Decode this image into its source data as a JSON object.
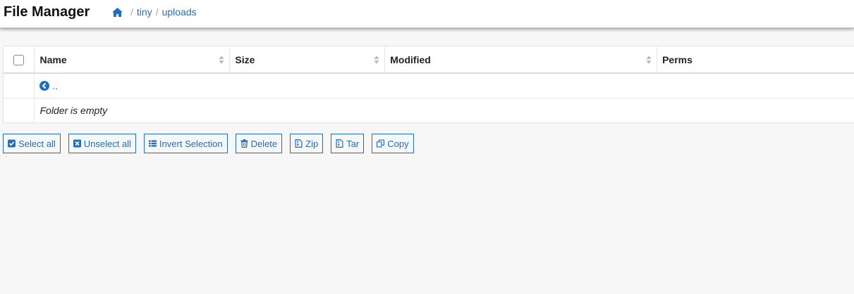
{
  "header": {
    "app_title": "File Manager",
    "breadcrumb": [
      {
        "label": "tiny"
      },
      {
        "label": "uploads"
      }
    ],
    "separator": "/"
  },
  "table": {
    "columns": {
      "name": "Name",
      "size": "Size",
      "modified": "Modified",
      "perms": "Perms"
    },
    "parent_link": "..",
    "empty_message": "Folder is empty"
  },
  "actions": {
    "select_all": "Select all",
    "unselect_all": "Unselect all",
    "invert_selection": "Invert Selection",
    "delete": "Delete",
    "zip": "Zip",
    "tar": "Tar",
    "copy": "Copy"
  },
  "colors": {
    "accent": "#1e6fbf",
    "background": "#f7f7f7",
    "header_bg": "#ffffff"
  },
  "icons": {
    "home": "home-icon",
    "sort": "sort-icon",
    "parent": "chevron-left-circle-icon",
    "select_all": "check-square-icon",
    "unselect_all": "x-square-icon",
    "invert": "list-icon",
    "delete": "trash-icon",
    "zip": "file-archive-icon",
    "tar": "file-archive-icon",
    "copy": "copy-icon"
  }
}
